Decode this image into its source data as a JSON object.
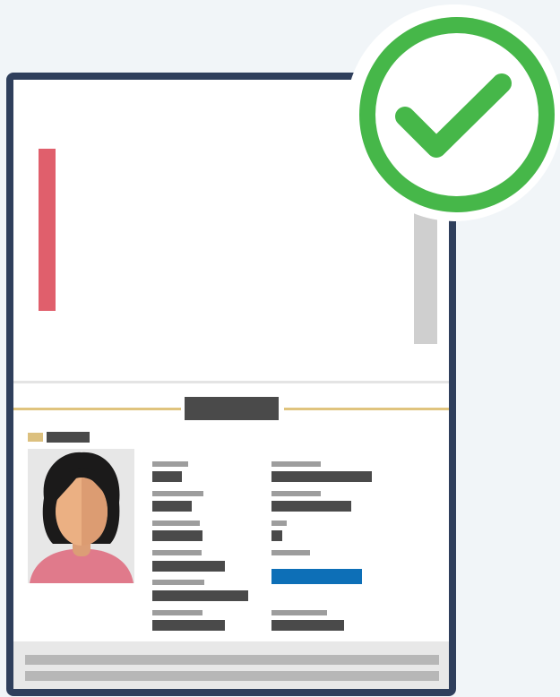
{
  "document": {
    "type_icon": "passport-card",
    "status": "verified",
    "colors": {
      "frame": "#2f3f5c",
      "accent_red": "#e05f6c",
      "gold": "#e0c47e",
      "highlight_blue": "#0d6fb7",
      "check_green": "#46b749"
    }
  },
  "badge": {
    "icon": "checkmark-icon"
  },
  "photo": {
    "icon": "person-avatar"
  }
}
